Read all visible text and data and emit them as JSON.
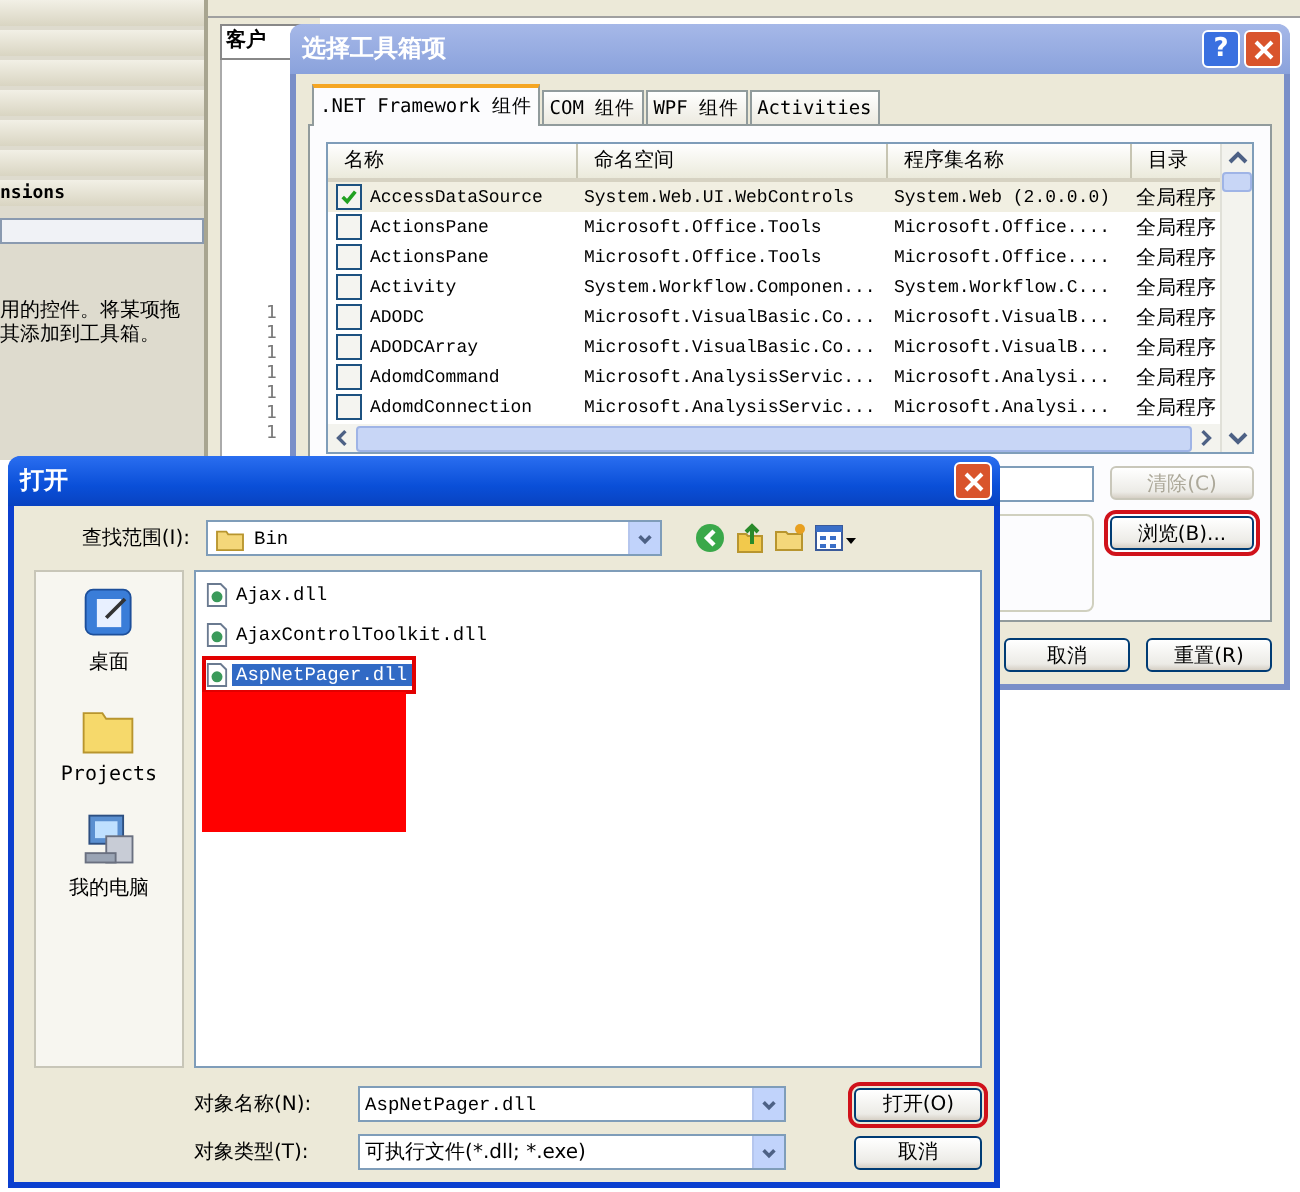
{
  "ide": {
    "left_panel": {
      "category_label": "nsions",
      "description_lines": [
        "用的控件。将某项拖",
        "其添加到工具箱。"
      ]
    },
    "document_tab": "客户",
    "line_numbers": [
      "1",
      "1",
      "1",
      "1",
      "1",
      "1",
      "1"
    ]
  },
  "toolbox_dialog": {
    "title": "选择工具箱项",
    "help_glyph": "?",
    "tabs": [
      {
        "label": ".NET Framework 组件",
        "selected": true
      },
      {
        "label": "COM 组件",
        "selected": false
      },
      {
        "label": "WPF 组件",
        "selected": false
      },
      {
        "label": "Activities",
        "selected": false
      }
    ],
    "columns": [
      "名称",
      "命名空间",
      "程序集名称",
      "目录"
    ],
    "rows": [
      {
        "name": "AccessDataSource",
        "namespace": "System.Web.UI.WebControls",
        "assembly": "System.Web (2.0.0.0)",
        "directory": "全局程序",
        "checked": true,
        "selected": true
      },
      {
        "name": "ActionsPane",
        "namespace": "Microsoft.Office.Tools",
        "assembly": "Microsoft.Office....",
        "directory": "全局程序",
        "checked": false,
        "selected": false
      },
      {
        "name": "ActionsPane",
        "namespace": "Microsoft.Office.Tools",
        "assembly": "Microsoft.Office....",
        "directory": "全局程序",
        "checked": false,
        "selected": false
      },
      {
        "name": "Activity",
        "namespace": "System.Workflow.Componen...",
        "assembly": "System.Workflow.C...",
        "directory": "全局程序",
        "checked": false,
        "selected": false
      },
      {
        "name": "ADODC",
        "namespace": "Microsoft.VisualBasic.Co...",
        "assembly": "Microsoft.VisualB...",
        "directory": "全局程序",
        "checked": false,
        "selected": false
      },
      {
        "name": "ADODCArray",
        "namespace": "Microsoft.VisualBasic.Co...",
        "assembly": "Microsoft.VisualB...",
        "directory": "全局程序",
        "checked": false,
        "selected": false
      },
      {
        "name": "AdomdCommand",
        "namespace": "Microsoft.AnalysisServic...",
        "assembly": "Microsoft.Analysi...",
        "directory": "全局程序",
        "checked": false,
        "selected": false
      },
      {
        "name": "AdomdConnection",
        "namespace": "Microsoft.AnalysisServic...",
        "assembly": "Microsoft.Analysi...",
        "directory": "全局程序",
        "checked": false,
        "selected": false
      }
    ],
    "clear_button": {
      "label": "清除(C)",
      "disabled": true
    },
    "browse_button": {
      "label": "浏览(B)...",
      "highlighted": true
    },
    "cancel_button": {
      "label": "取消"
    },
    "reset_button": {
      "label": "重置(R)"
    }
  },
  "open_dialog": {
    "title": "打开",
    "look_in": {
      "label": "查找范围(I):",
      "value": "Bin"
    },
    "places": [
      {
        "label": "桌面",
        "kind": "desktop"
      },
      {
        "label": "Projects",
        "kind": "folder"
      },
      {
        "label": "我的电脑",
        "kind": "computer"
      }
    ],
    "files": [
      {
        "name": "Ajax.dll",
        "selected": false,
        "highlighted": false
      },
      {
        "name": "AjaxControlToolkit.dll",
        "selected": false,
        "highlighted": false
      },
      {
        "name": "AspNetPager.dll",
        "selected": true,
        "highlighted": true
      }
    ],
    "redaction": {
      "kind": "red-block"
    },
    "file_name": {
      "label": "对象名称(N):",
      "value": "AspNetPager.dll"
    },
    "file_type": {
      "label": "对象类型(T):",
      "value": "可执行文件(*.dll; *.exe)"
    },
    "open_button": {
      "label": "打开(O)",
      "highlighted": true
    },
    "cancel_button": {
      "label": "取消"
    }
  }
}
